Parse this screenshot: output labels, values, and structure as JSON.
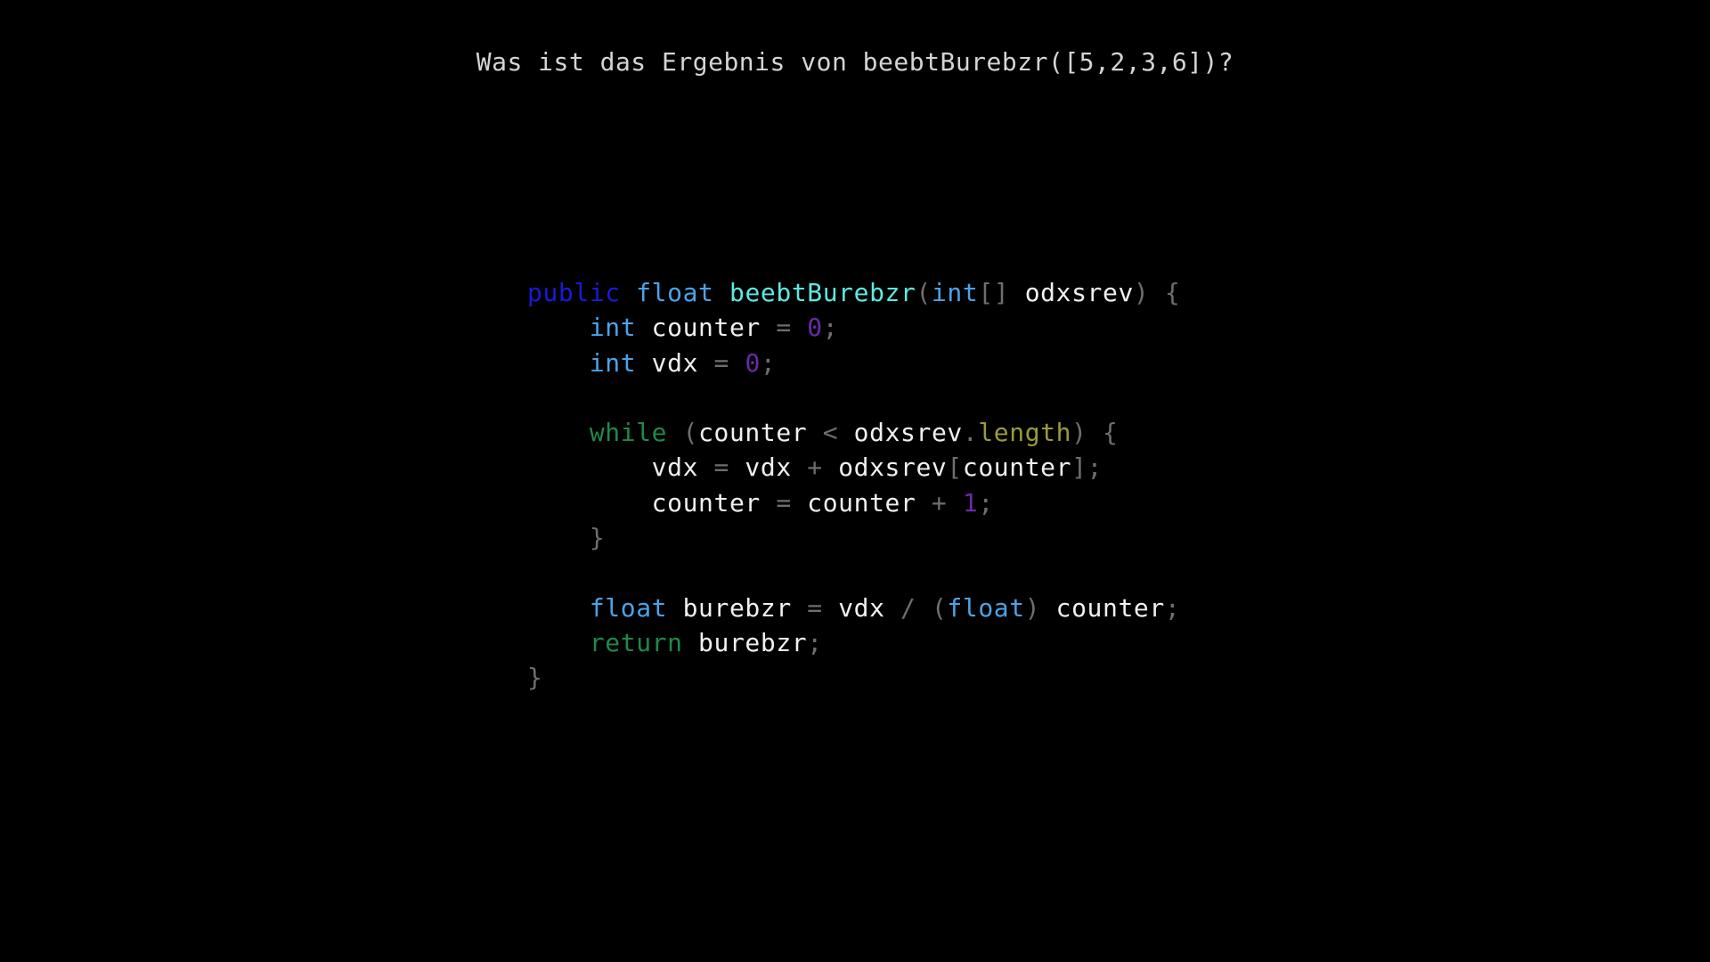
{
  "question": "Was ist das Ergebnis von beebtBurebzr([5,2,3,6])?",
  "colors": {
    "background": "#000000",
    "keyword_public": "#1a1ad6",
    "type": "#4aa3e8",
    "function_name": "#5fe8e0",
    "identifier": "#f0f0f0",
    "punctuation": "#6e6e6e",
    "number": "#6a2aa8",
    "control": "#20894a",
    "property": "#9a9a3a"
  },
  "code_lines": [
    [
      {
        "t": "public",
        "k": "keyword-public"
      },
      {
        "t": " ",
        "k": "ident"
      },
      {
        "t": "float",
        "k": "type"
      },
      {
        "t": " ",
        "k": "ident"
      },
      {
        "t": "beebtBurebzr",
        "k": "func"
      },
      {
        "t": "(",
        "k": "punct"
      },
      {
        "t": "int",
        "k": "type"
      },
      {
        "t": "[]",
        "k": "punct"
      },
      {
        "t": " odxsrev",
        "k": "ident"
      },
      {
        "t": ") {",
        "k": "punct"
      }
    ],
    [
      {
        "t": "    ",
        "k": "ident"
      },
      {
        "t": "int",
        "k": "type"
      },
      {
        "t": " counter ",
        "k": "ident"
      },
      {
        "t": "= ",
        "k": "punct"
      },
      {
        "t": "0",
        "k": "number"
      },
      {
        "t": ";",
        "k": "punct"
      }
    ],
    [
      {
        "t": "    ",
        "k": "ident"
      },
      {
        "t": "int",
        "k": "type"
      },
      {
        "t": " vdx ",
        "k": "ident"
      },
      {
        "t": "= ",
        "k": "punct"
      },
      {
        "t": "0",
        "k": "number"
      },
      {
        "t": ";",
        "k": "punct"
      }
    ],
    [],
    [
      {
        "t": "    ",
        "k": "ident"
      },
      {
        "t": "while",
        "k": "control"
      },
      {
        "t": " (",
        "k": "punct"
      },
      {
        "t": "counter ",
        "k": "ident"
      },
      {
        "t": "< ",
        "k": "punct"
      },
      {
        "t": "odxsrev",
        "k": "ident"
      },
      {
        "t": ".",
        "k": "punct"
      },
      {
        "t": "length",
        "k": "prop"
      },
      {
        "t": ") {",
        "k": "punct"
      }
    ],
    [
      {
        "t": "        vdx ",
        "k": "ident"
      },
      {
        "t": "= ",
        "k": "punct"
      },
      {
        "t": "vdx ",
        "k": "ident"
      },
      {
        "t": "+ ",
        "k": "punct"
      },
      {
        "t": "odxsrev",
        "k": "ident"
      },
      {
        "t": "[",
        "k": "punct"
      },
      {
        "t": "counter",
        "k": "ident"
      },
      {
        "t": "];",
        "k": "punct"
      }
    ],
    [
      {
        "t": "        counter ",
        "k": "ident"
      },
      {
        "t": "= ",
        "k": "punct"
      },
      {
        "t": "counter ",
        "k": "ident"
      },
      {
        "t": "+ ",
        "k": "punct"
      },
      {
        "t": "1",
        "k": "number"
      },
      {
        "t": ";",
        "k": "punct"
      }
    ],
    [
      {
        "t": "    ",
        "k": "ident"
      },
      {
        "t": "}",
        "k": "punct"
      }
    ],
    [],
    [
      {
        "t": "    ",
        "k": "ident"
      },
      {
        "t": "float",
        "k": "type"
      },
      {
        "t": " burebzr ",
        "k": "ident"
      },
      {
        "t": "= ",
        "k": "punct"
      },
      {
        "t": "vdx ",
        "k": "ident"
      },
      {
        "t": "/ (",
        "k": "punct"
      },
      {
        "t": "float",
        "k": "type"
      },
      {
        "t": ") ",
        "k": "punct"
      },
      {
        "t": "counter",
        "k": "ident"
      },
      {
        "t": ";",
        "k": "punct"
      }
    ],
    [
      {
        "t": "    ",
        "k": "ident"
      },
      {
        "t": "return",
        "k": "control"
      },
      {
        "t": " burebzr",
        "k": "ident"
      },
      {
        "t": ";",
        "k": "punct"
      }
    ],
    [
      {
        "t": "}",
        "k": "punct"
      }
    ]
  ]
}
